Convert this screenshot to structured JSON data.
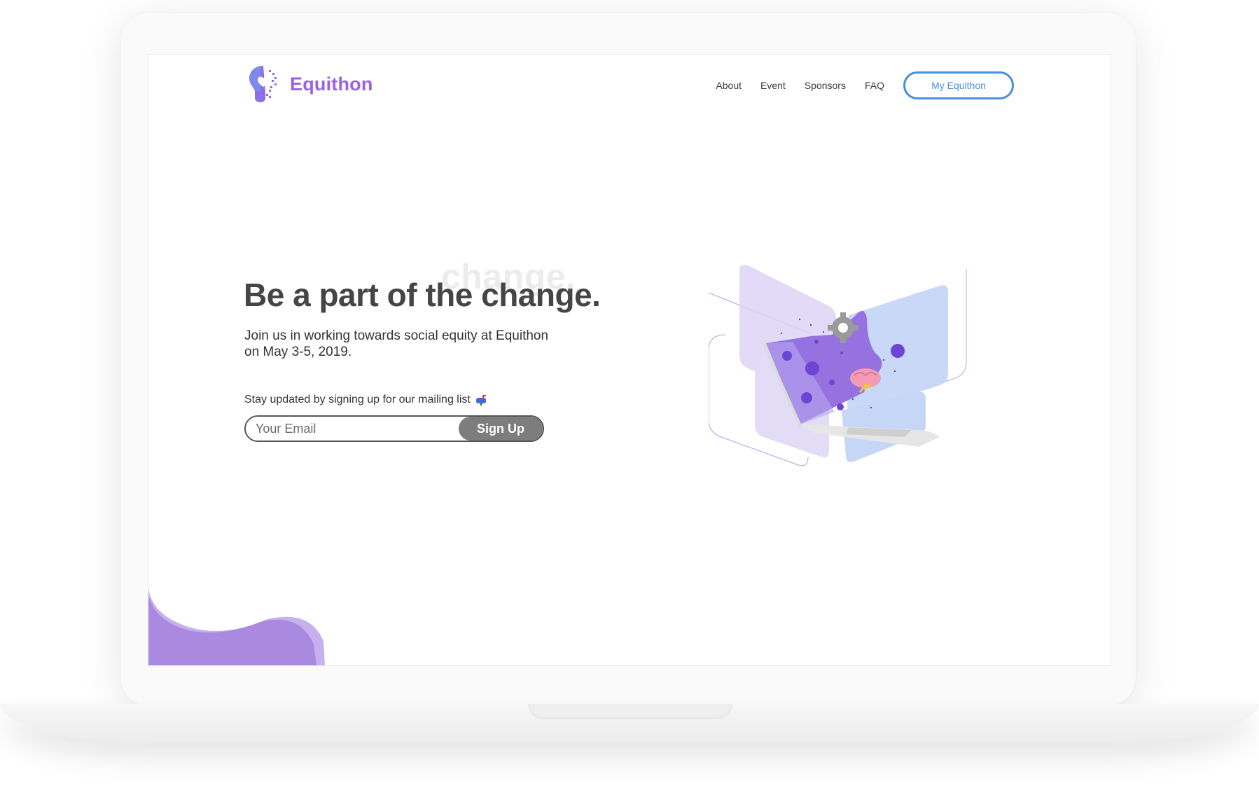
{
  "brand": {
    "name": "Equithon"
  },
  "nav": {
    "links": [
      "About",
      "Event",
      "Sponsors",
      "FAQ"
    ],
    "cta": "My Equithon"
  },
  "hero": {
    "ghost_word": "change.",
    "title": "Be a part of the change.",
    "subtitle": "Join us in working towards social equity at Equithon on May 3-5, 2019."
  },
  "mailing": {
    "label": "Stay updated by signing up for our mailing list",
    "email_placeholder": "Your Email",
    "button": "Sign Up"
  },
  "colors": {
    "brand_purple": "#9a63e6",
    "button_blue": "#4a8ee0",
    "signup_grey": "#7d7d7d"
  },
  "icons": [
    "lightbulb-logo-icon",
    "mailbox-icon",
    "laptop-illustration",
    "gear-icon",
    "brain-icon"
  ]
}
